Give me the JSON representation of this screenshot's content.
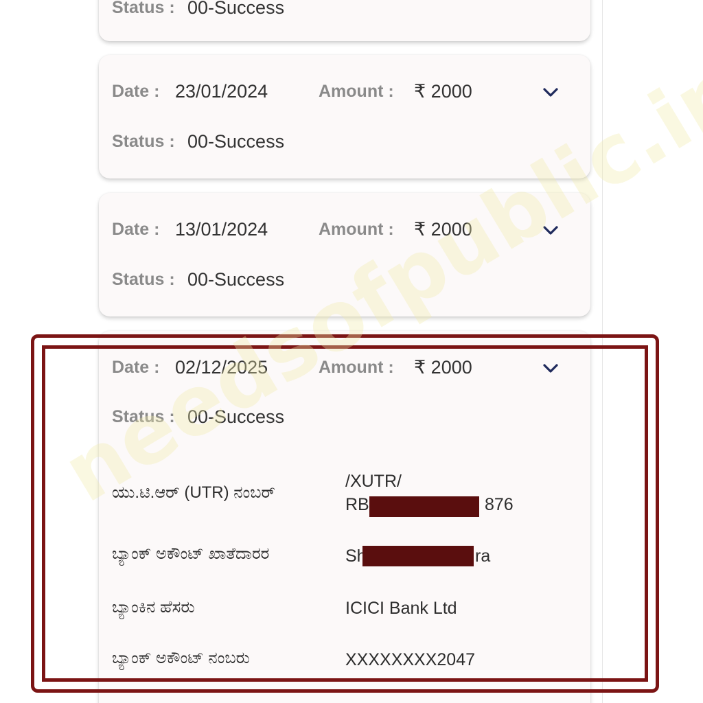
{
  "labels": {
    "date": "Date :",
    "amount": "Amount :",
    "status": "Status :"
  },
  "transactions": [
    {
      "status": "00-Success"
    },
    {
      "date": "23/01/2024",
      "amount": "₹ 2000",
      "status": "00-Success"
    },
    {
      "date": "13/01/2024",
      "amount": "₹ 2000",
      "status": "00-Success"
    },
    {
      "date": "02/12/2025",
      "amount": "₹ 2000",
      "status": "00-Success"
    }
  ],
  "details": {
    "utr_label": "ಯು.ಟಿ.ಆರ್ (UTR) ನಂಬರ್",
    "utr_value_line1": "/XUTR/",
    "utr_value_line2_start": "RB",
    "utr_value_line2_end": "876",
    "holder_label": "ಬ್ಯಾಂಕ್ ಅಕೌಂಟ್ ಖಾತೆದಾರರ",
    "holder_value_start": "Sh",
    "holder_value_end": "ra",
    "bank_name_label": "ಬ್ಯಾಂಕಿನ ಹೆಸರು",
    "bank_name_value": "ICICI Bank Ltd",
    "account_number_label": "ಬ್ಯಾಂಕ್ ಅಕೌಂಟ್ ನಂಬರು",
    "account_number_value": "XXXXXXXX2047"
  },
  "icons": {
    "expand": "chevron-down-icon"
  },
  "watermark": "needsofpublic.in",
  "colors": {
    "card_bg": "#fcf9f9",
    "label": "#8a8a8a",
    "value": "#333333",
    "chevron": "#1f2a5c",
    "highlight_frame": "#7b1414",
    "redaction": "#5a0e0e"
  }
}
